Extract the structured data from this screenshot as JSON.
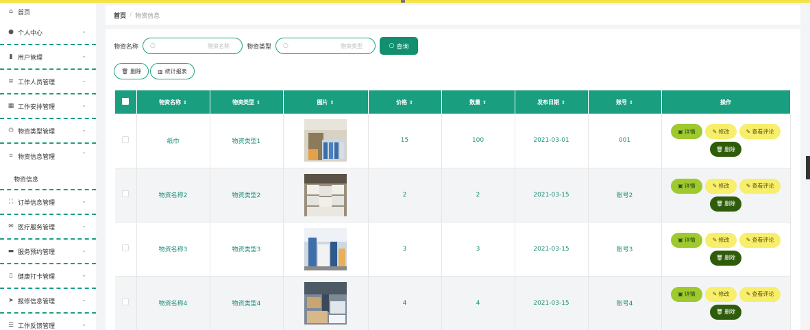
{
  "sidebar": {
    "items": [
      {
        "label": "首页",
        "icon": "home-icon"
      },
      {
        "label": "个人中心",
        "icon": "user-icon"
      },
      {
        "label": "用户管理",
        "icon": "user-manage-icon"
      },
      {
        "label": "工作人员管理",
        "icon": "list-icon"
      },
      {
        "label": "工作安排管理",
        "icon": "grid-icon"
      },
      {
        "label": "物资类型管理",
        "icon": "power-icon"
      },
      {
        "label": "物资信息管理",
        "icon": "crop-icon"
      },
      {
        "label": "订单信息管理",
        "icon": "fullscreen-icon"
      },
      {
        "label": "医疗服务管理",
        "icon": "mail-icon"
      },
      {
        "label": "服务预约管理",
        "icon": "printer-icon"
      },
      {
        "label": "健康打卡管理",
        "icon": "microphone-icon"
      },
      {
        "label": "报修信息管理",
        "icon": "send-icon"
      },
      {
        "label": "工作反馈管理",
        "icon": "sliders-icon"
      }
    ],
    "sub_item": "物资信息"
  },
  "breadcrumb": {
    "home": "首页",
    "sep": "/",
    "current": "物资信息"
  },
  "search": {
    "name_label": "物资名称",
    "name_placeholder": "物资名称",
    "type_label": "物资类型",
    "type_placeholder": "物资类型",
    "query_button": "查询"
  },
  "actions": {
    "delete": "删除",
    "stats": "统计报表"
  },
  "table": {
    "headers": [
      "物资名称",
      "物资类型",
      "图片",
      "价格",
      "数量",
      "发布日期",
      "账号",
      "操作"
    ],
    "rows": [
      {
        "name": "纸巾",
        "type": "物资类型1",
        "price": "15",
        "qty": "100",
        "date": "2021-03-01",
        "account": "001"
      },
      {
        "name": "物资名称2",
        "type": "物资类型2",
        "price": "2",
        "qty": "2",
        "date": "2021-03-15",
        "account": "账号2"
      },
      {
        "name": "物资名称3",
        "type": "物资类型3",
        "price": "3",
        "qty": "3",
        "date": "2021-03-15",
        "account": "账号3"
      },
      {
        "name": "物资名称4",
        "type": "物资类型4",
        "price": "4",
        "qty": "4",
        "date": "2021-03-15",
        "account": "账号4"
      }
    ],
    "ops": {
      "detail": "详情",
      "edit": "修改",
      "review": "查看评论",
      "delete": "删除"
    }
  },
  "colors": {
    "accent": "#1a9e80",
    "top_strip": "#f5e342",
    "detail": "#9ec92f",
    "edit": "#f7ee6b",
    "delete": "#2f5c0b"
  }
}
